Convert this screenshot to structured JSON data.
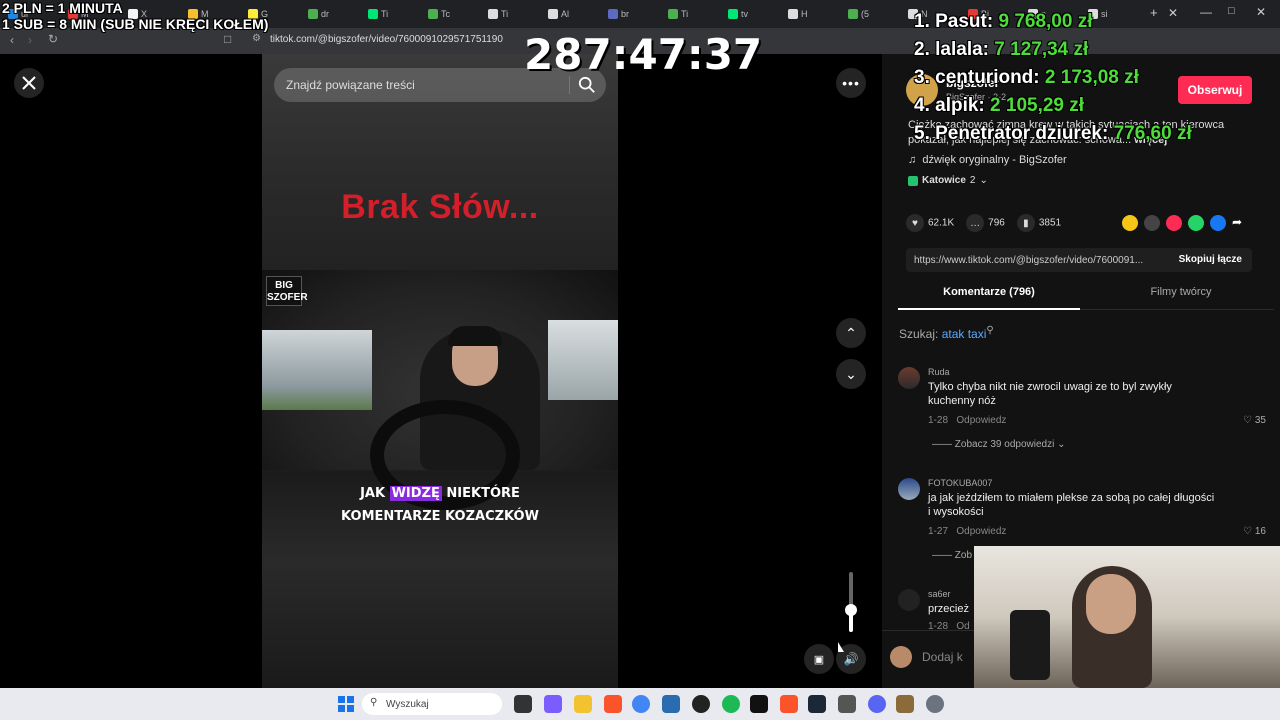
{
  "browser": {
    "url": "tiktok.com/@bigszofer/video/7600091029571751190",
    "tabs": [
      "ul",
      "M",
      "X",
      "M",
      "G",
      "dr",
      "Ti",
      "Tc",
      "Ti",
      "Al",
      "br",
      "Ti",
      "tv",
      "H",
      "(5",
      "N",
      "Bi",
      "p",
      "si"
    ]
  },
  "stream_overlay": {
    "line1": "2 PLN = 1 MINUTA",
    "line2": "1 SUB = 8 MIN (SUB NIE KRĘCI KOŁEM)",
    "timer": "287:47:37",
    "leaderboard": [
      {
        "rank_name": "1. Pasut:",
        "amount": "9 768,00 zł"
      },
      {
        "rank_name": "2. lalala:",
        "amount": "7 127,34 zł"
      },
      {
        "rank_name": "3. centuriond:",
        "amount": "2 173,08 zł"
      },
      {
        "rank_name": "4. alpik:",
        "amount": "2 105,29 zł"
      },
      {
        "rank_name": "5. Penetrator dziurek:",
        "amount": "776,60 zł"
      }
    ]
  },
  "video": {
    "search_placeholder": "Znajdź powiązane treści",
    "headline": "Brak Słów...",
    "logo_text": "BIG SZOFER",
    "caption_line1_pre": "JAK ",
    "caption_line1_hl": "WIDZĘ",
    "caption_line1_post": " NIEKTÓRE",
    "caption_line2": "KOMENTARZE KOZACZKÓW"
  },
  "creator": {
    "name": "bigszofer",
    "sub": "BigSzofer · 2-2",
    "follow_label": "Obserwuj",
    "description": "Ciężko zachować zimną krew w takich sytuacjach,a ten kierowca pokazał, jak najlepiej się zachować: schowa...",
    "more_label": "więcej",
    "sound": "dźwięk oryginalny - BigSzofer",
    "location": "Katowice",
    "location_count": "2"
  },
  "stats": {
    "likes": "62.1K",
    "comments": "796",
    "saves": "3851"
  },
  "link": {
    "url": "https://www.tiktok.com/@bigszofer/video/7600091...",
    "copy_label": "Skopiuj łącze"
  },
  "tabs": {
    "comments": "Komentarze (796)",
    "creator_videos": "Filmy twórcy"
  },
  "search": {
    "prefix": "Szukaj:",
    "term": "atak taxi"
  },
  "comments": [
    {
      "user": "Ruda",
      "text": "Tylko chyba nikt nie zwrocil uwagi ze to byl zwykły kuchenny nóż",
      "date": "1-28",
      "reply": "Odpowiedz",
      "likes": "35",
      "replies": "Zobacz 39 odpowiedzi"
    },
    {
      "user": "FOTOKUBA007",
      "text": "ja jak jeździłem to miałem plekse za sobą po całej długości i wysokości",
      "date": "1-27",
      "reply": "Odpowiedz",
      "likes": "16",
      "replies": "Zob"
    },
    {
      "user": "sa6er",
      "text": "przecież",
      "date": "1-28",
      "reply": "Od"
    }
  ],
  "add_comment_placeholder": "Dodaj k",
  "taskbar": {
    "search_placeholder": "Wyszukaj"
  },
  "colors": {
    "accent": "#fe2c55",
    "headline": "#d41e2a",
    "leaderboard_amount": "#4ddc3a",
    "link": "#5ba9ff"
  }
}
